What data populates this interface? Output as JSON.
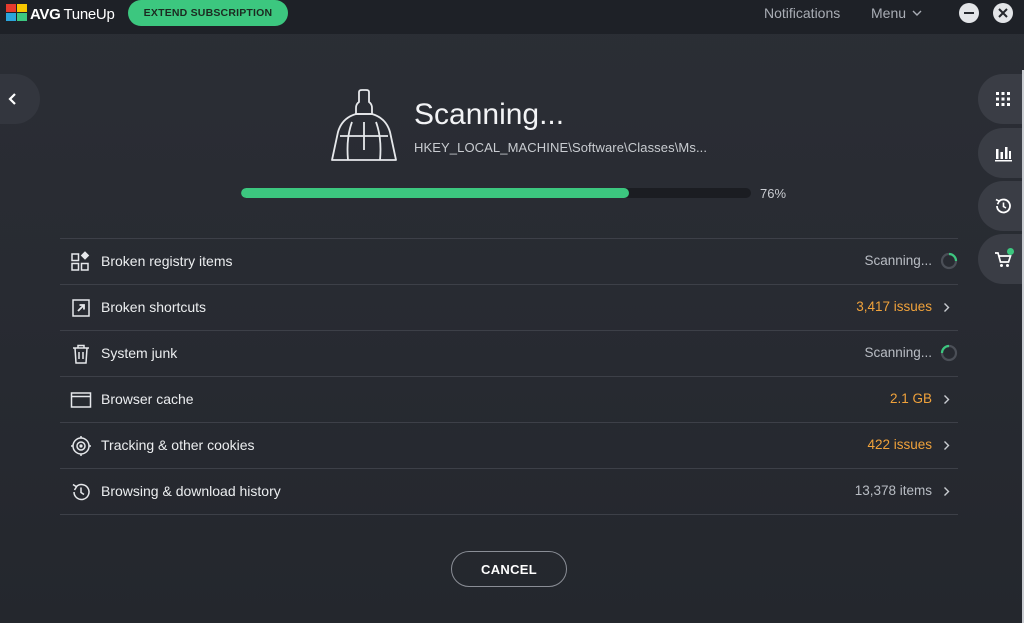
{
  "titlebar": {
    "brand": "AVG",
    "product": "TuneUp",
    "extend_label": "EXTEND SUBSCRIPTION",
    "notifications_label": "Notifications",
    "menu_label": "Menu"
  },
  "scan": {
    "title": "Scanning...",
    "path": "HKEY_LOCAL_MACHINE\\Software\\Classes\\Ms...",
    "progress": 0.76,
    "progress_label": "76%"
  },
  "items": [
    {
      "label": "Broken registry items",
      "status": "Scanning...",
      "state": "scanning",
      "icon": "registry-icon"
    },
    {
      "label": "Broken shortcuts",
      "status": "3,417 issues",
      "state": "issue",
      "icon": "shortcut-icon"
    },
    {
      "label": "System junk",
      "status": "Scanning...",
      "state": "scanning",
      "icon": "trash-icon"
    },
    {
      "label": "Browser cache",
      "status": "2.1 GB",
      "state": "issue",
      "icon": "browser-icon"
    },
    {
      "label": "Tracking & other cookies",
      "status": "422 issues",
      "state": "issue",
      "icon": "tracking-icon"
    },
    {
      "label": "Browsing & download history",
      "status": "13,378 items",
      "state": "neutral",
      "icon": "history-icon"
    }
  ],
  "cancel_label": "CANCEL",
  "side_buttons": [
    "apps-grid-icon",
    "chart-icon",
    "history-icon",
    "cart-icon"
  ],
  "colors": {
    "accent": "#3cc77f",
    "warning": "#f0a23b",
    "background": "#272a31"
  }
}
